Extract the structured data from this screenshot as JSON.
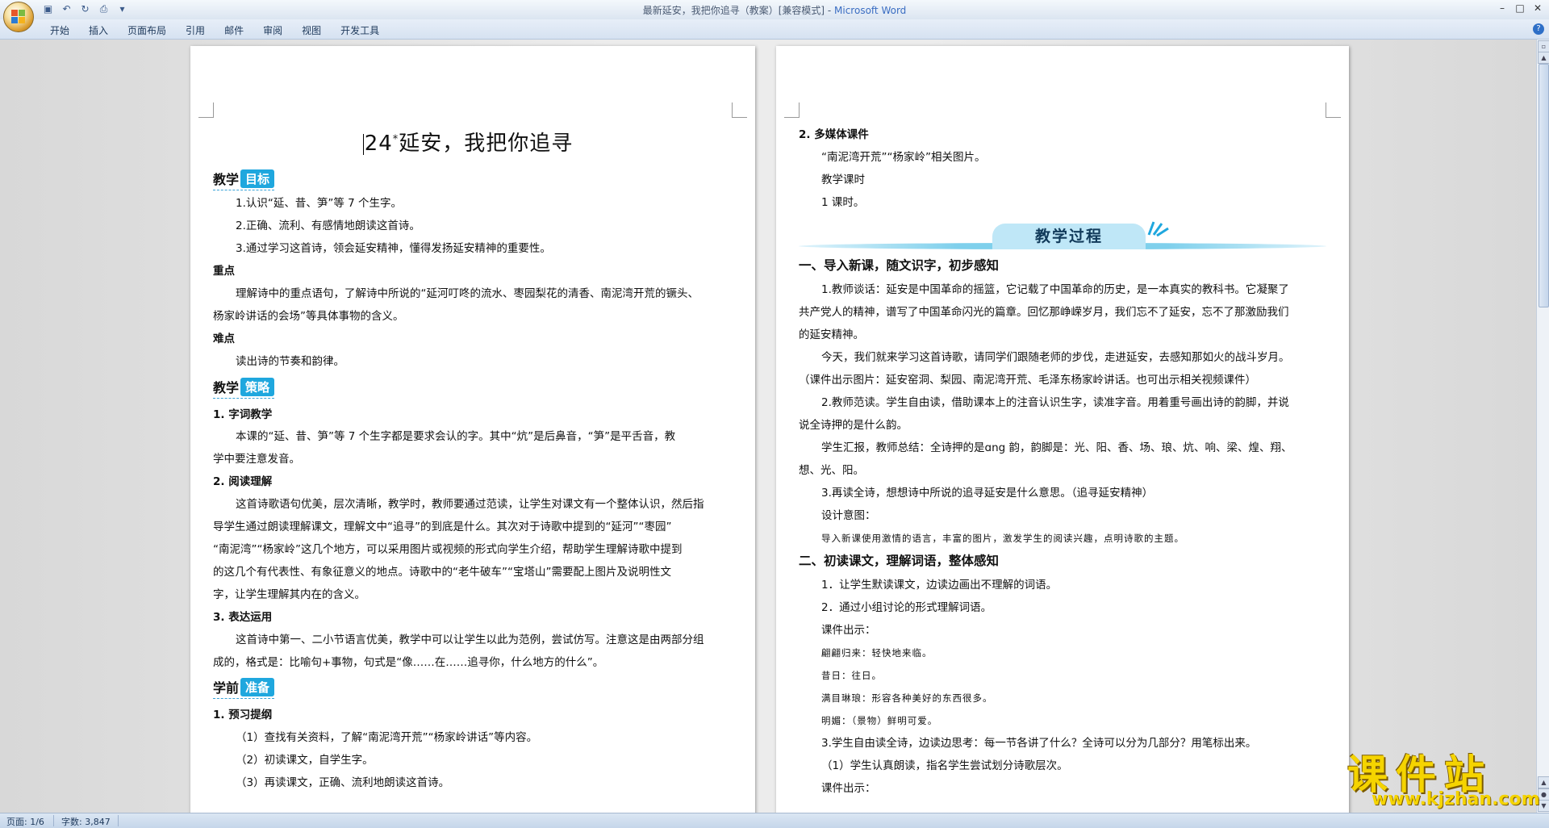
{
  "window": {
    "title": "最新延安，我把你追寻（教案）[兼容模式] - ",
    "app_name": "Microsoft Word",
    "minimize": "–",
    "maximize": "□",
    "close": "✕"
  },
  "ribbon": {
    "tabs": [
      "开始",
      "插入",
      "页面布局",
      "引用",
      "邮件",
      "审阅",
      "视图",
      "开发工具"
    ]
  },
  "left_page": {
    "heading_num": "24",
    "heading_star": "*",
    "heading_text": "延安，我把你追寻",
    "goal_tag": [
      "教学",
      "目标"
    ],
    "goals": [
      "1.认识“延、昔、笋”等 7 个生字。",
      "2.正确、流利、有感情地朗读这首诗。",
      "3.通过学习这首诗，领会延安精神，懂得发扬延安精神的重要性。"
    ],
    "key_label": "重点",
    "key_text_1": "理解诗中的重点语句，了解诗中所说的“延河叮咚的流水、枣园梨花的清香、南泥湾开荒的镢头、",
    "key_text_2": "杨家岭讲话的会场”等具体事物的含义。",
    "diff_label": "难点",
    "diff_text": "读出诗的节奏和韵律。",
    "strategy_tag": [
      "教学",
      "策略"
    ],
    "s1_title": "1. 字词教学",
    "s1_lines": [
      "本课的“延、昔、笋”等 7 个生字都是要求会认的字。其中“炕”是后鼻音，“笋”是平舌音，教",
      "学中要注意发音。"
    ],
    "s2_title": "2. 阅读理解",
    "s2_lines": [
      "这首诗歌语句优美，层次清晰，教学时，教师要通过范读，让学生对课文有一个整体认识，然后指",
      "导学生通过朗读理解课文，理解文中“追寻”的到底是什么。其次对于诗歌中提到的“延河”“枣园”",
      "“南泥湾”“杨家岭”这几个地方，可以采用图片或视频的形式向学生介绍，帮助学生理解诗歌中提到",
      "的这几个有代表性、有象征意义的地点。诗歌中的“老牛破车”“宝塔山”需要配上图片及说明性文",
      "字，让学生理解其内在的含义。"
    ],
    "s3_title": "3. 表达运用",
    "s3_lines": [
      "这首诗中第一、二小节语言优美，教学中可以让学生以此为范例，尝试仿写。注意这是由两部分组",
      "成的，格式是：比喻句+事物，句式是“像……在……追寻你，什么地方的什么”。"
    ],
    "prep_tag": [
      "学前",
      "准备"
    ],
    "p1_title": "1. 预习提纲",
    "p1_lines": [
      "（1）查找有关资料，了解“南泥湾开荒”“杨家岭讲话”等内容。",
      "（2）初读课文，自学生字。",
      "（3）再读课文，正确、流利地朗读这首诗。"
    ]
  },
  "right_page": {
    "m_title": "2. 多媒体课件",
    "m_line": "“南泥湾开荒”“杨家岭”相关图片。",
    "time_label": "教学课时",
    "time_value": "1 课时。",
    "banner": "教学过程",
    "sec1": "一、导入新课，随文识字，初步感知",
    "sec1_lines": [
      "1.教师谈话：延安是中国革命的摇篮，它记载了中国革命的历史，是一本真实的教科书。它凝聚了",
      "共产党人的精神，谱写了中国革命闪光的篇章。回忆那峥嵘岁月，我们忘不了延安，忘不了那激励我们",
      "的延安精神。",
      "今天，我们就来学习这首诗歌，请同学们跟随老师的步伐，走进延安，去感知那如火的战斗岁月。",
      "（课件出示图片：延安窑洞、梨园、南泥湾开荒、毛泽东杨家岭讲话。也可出示相关视频课件）",
      "2.教师范读。学生自由读，借助课本上的注音认识生字，读准字音。用着重号画出诗的韵脚，并说",
      "说全诗押的是什么韵。",
      "学生汇报，教师总结：全诗押的是ɑng 韵，韵脚是：光、阳、香、场、琅、炕、响、梁、煌、翔、",
      "想、光、阳。",
      "3.再读全诗，想想诗中所说的追寻延安是什么意思。（追寻延安精神）",
      "设计意图：",
      "导入新课使用激情的语言，丰富的图片，激发学生的阅读兴趣，点明诗歌的主题。"
    ],
    "sec2": "二、初读课文，理解词语，整体感知",
    "sec2_lines": [
      "1．让学生默读课文，边读边画出不理解的词语。",
      "2．通过小组讨论的形式理解词语。",
      "课件出示：",
      "翩翩归来：轻快地来临。",
      "昔日：往日。",
      "满目琳琅：形容各种美好的东西很多。",
      "明媚：（景物）鲜明可爱。",
      "3.学生自由读全诗，边读边思考：每一节各讲了什么？全诗可以分为几部分？用笔标出来。",
      "（1）学生认真朗读，指名学生尝试划分诗歌层次。",
      "课件出示："
    ]
  },
  "statusbar": {
    "page": "页面: 1/6",
    "words": "字数: 3,847"
  },
  "watermark": {
    "big": "课件站",
    "url": "www.kjzhan.com"
  },
  "colors": {
    "accent": "#1fa7de",
    "banner": "#bfe7f7",
    "watermark": "#f5d400"
  }
}
